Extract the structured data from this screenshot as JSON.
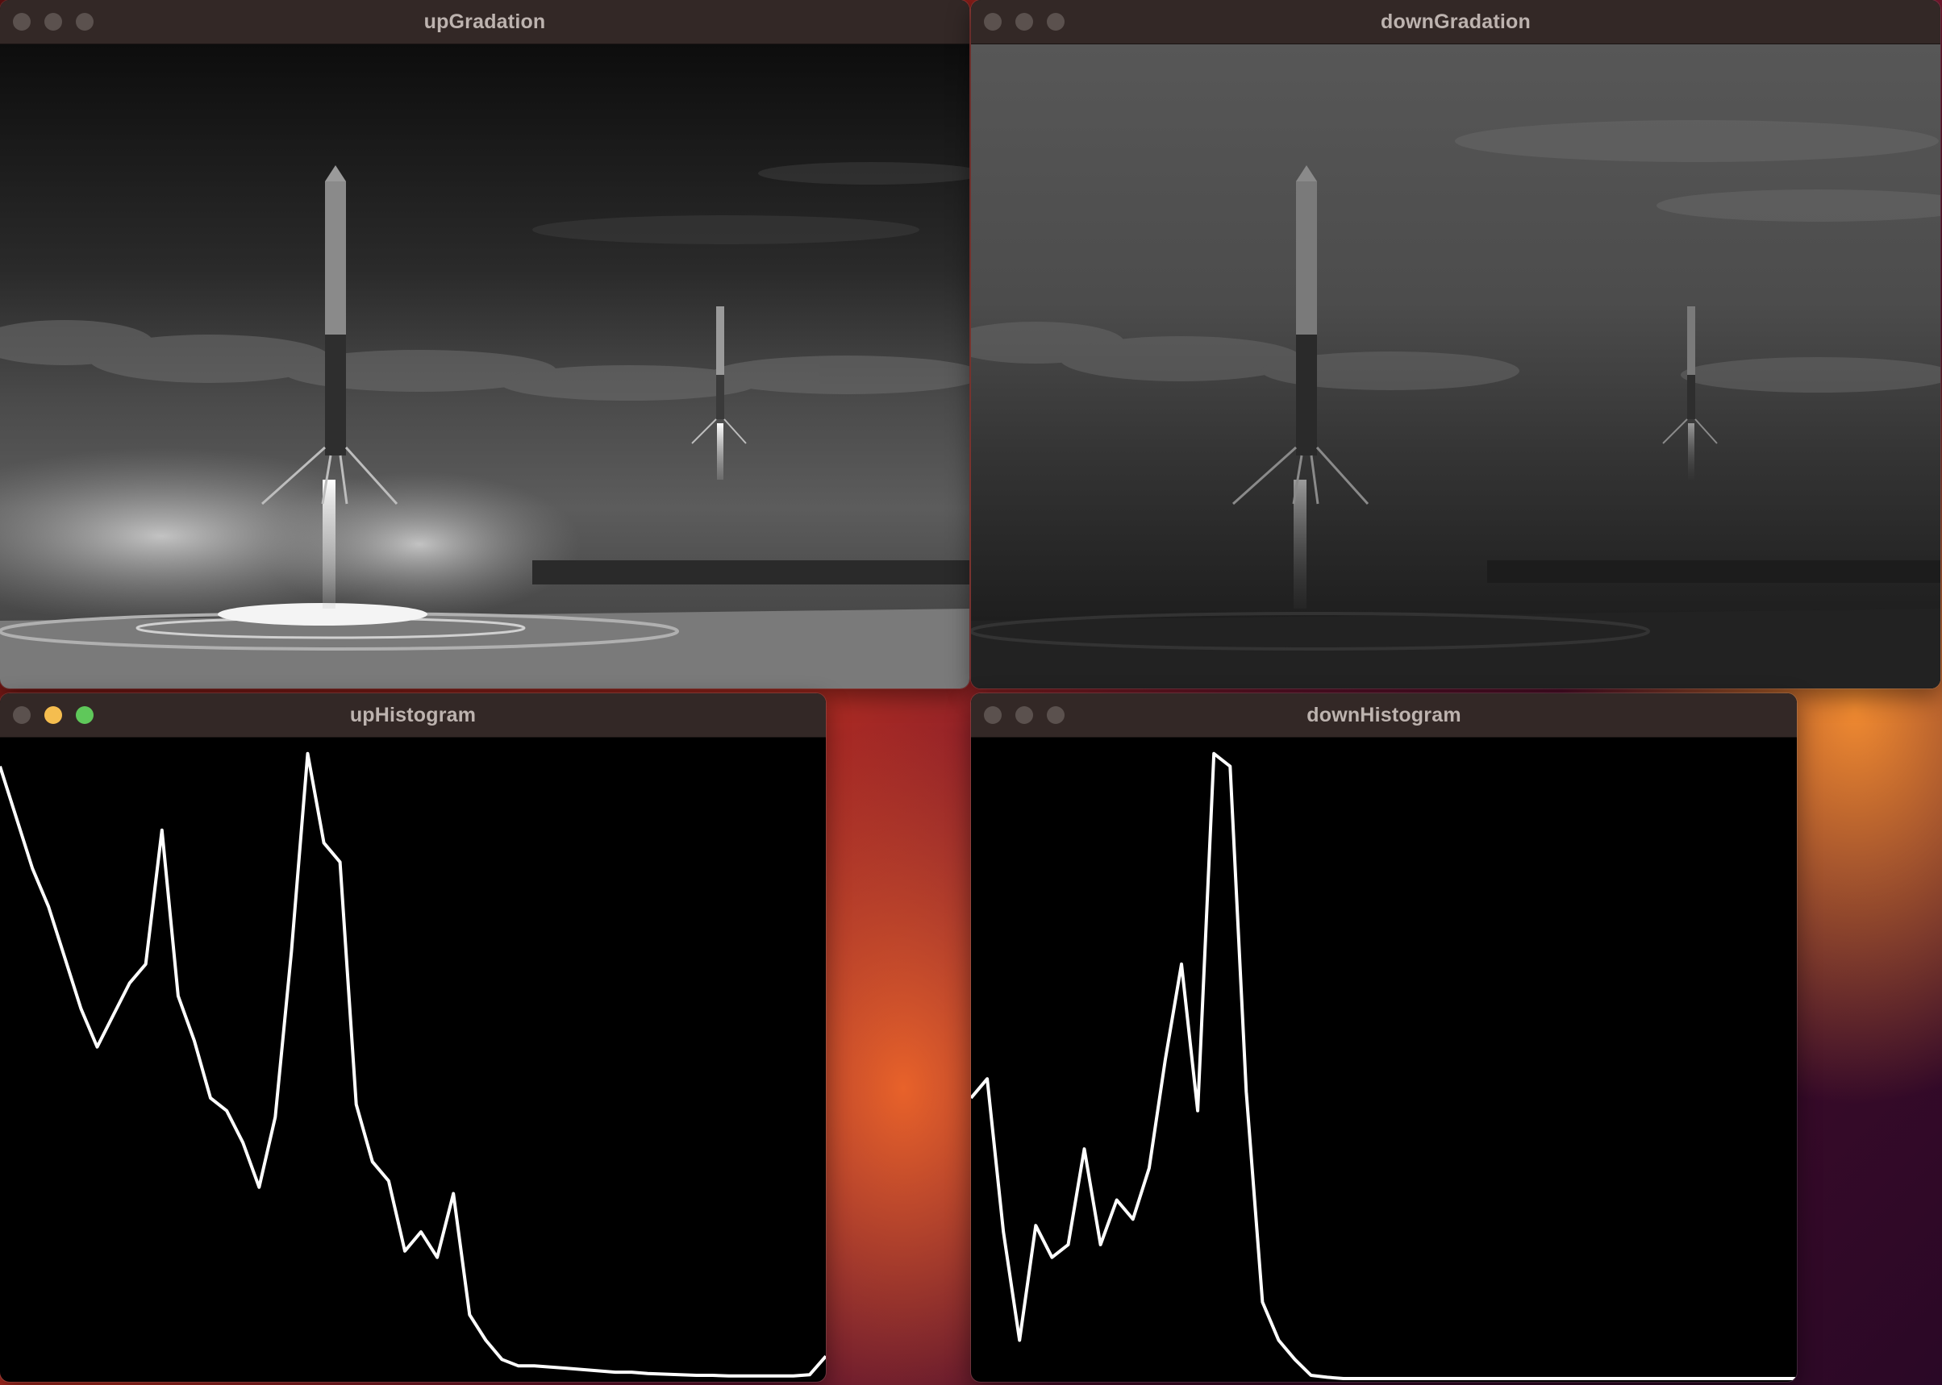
{
  "windows": {
    "up_gradation": {
      "title": "upGradation"
    },
    "down_gradation": {
      "title": "downGradation"
    },
    "up_histogram": {
      "title": "upHistogram"
    },
    "down_histogram": {
      "title": "downHistogram"
    }
  },
  "colors": {
    "titlebar": "#332826",
    "title_text": "#bdb3af",
    "traffic_close": "#5b514e",
    "traffic_minimize_active": "#f5bd4f",
    "traffic_maximize_active": "#5fc85a",
    "histogram_line": "#ffffff"
  },
  "chart_data": [
    {
      "type": "line",
      "window": "upHistogram",
      "x": [
        0,
        5,
        10,
        15,
        20,
        25,
        30,
        35,
        40,
        45,
        50,
        55,
        60,
        65,
        70,
        75,
        80,
        85,
        90,
        95,
        100,
        105,
        110,
        115,
        120,
        125,
        130,
        135,
        140,
        145,
        150,
        155,
        160,
        165,
        170,
        175,
        180,
        185,
        190,
        195,
        200,
        205,
        210,
        215,
        220,
        225,
        230,
        235,
        240,
        245,
        250,
        255
      ],
      "values": [
        0.96,
        0.88,
        0.8,
        0.74,
        0.66,
        0.58,
        0.52,
        0.57,
        0.62,
        0.65,
        0.86,
        0.6,
        0.53,
        0.44,
        0.42,
        0.37,
        0.3,
        0.41,
        0.67,
        0.98,
        0.84,
        0.81,
        0.43,
        0.34,
        0.31,
        0.2,
        0.23,
        0.19,
        0.29,
        0.1,
        0.06,
        0.03,
        0.02,
        0.02,
        0.018,
        0.016,
        0.014,
        0.012,
        0.01,
        0.01,
        0.008,
        0.007,
        0.006,
        0.005,
        0.005,
        0.004,
        0.004,
        0.004,
        0.004,
        0.004,
        0.006,
        0.035
      ],
      "ylim": [
        0,
        1
      ]
    },
    {
      "type": "line",
      "window": "downHistogram",
      "x": [
        0,
        5,
        10,
        15,
        20,
        25,
        30,
        35,
        40,
        45,
        50,
        55,
        60,
        65,
        70,
        75,
        80,
        85,
        90,
        95,
        100,
        105,
        110,
        115,
        120,
        125,
        130,
        135,
        140,
        145,
        150,
        155,
        160,
        165,
        170,
        175,
        180,
        185,
        190,
        195,
        200,
        205,
        210,
        215,
        220,
        225,
        230,
        235,
        240,
        245,
        250,
        255
      ],
      "values": [
        0.44,
        0.47,
        0.23,
        0.06,
        0.24,
        0.19,
        0.21,
        0.36,
        0.21,
        0.28,
        0.25,
        0.33,
        0.5,
        0.65,
        0.42,
        0.98,
        0.96,
        0.45,
        0.12,
        0.06,
        0.03,
        0.005,
        0.002,
        0,
        0,
        0,
        0,
        0,
        0,
        0,
        0,
        0,
        0,
        0,
        0,
        0,
        0,
        0,
        0,
        0,
        0,
        0,
        0,
        0,
        0,
        0,
        0,
        0,
        0,
        0,
        0,
        0
      ],
      "ylim": [
        0,
        1
      ]
    }
  ]
}
